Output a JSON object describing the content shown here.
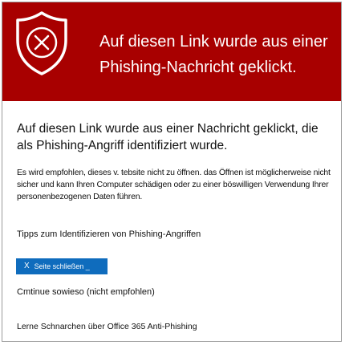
{
  "banner": {
    "title": "Auf diesen Link wurde aus einer Phishing-Nachricht geklickt.",
    "icon": "shield-x-icon",
    "color": "#a80000"
  },
  "body": {
    "headline": "Auf diesen Link wurde aus einer Nachricht geklickt, die als Phishing-Angriff identifiziert wurde.",
    "description": "Es wird empfohlen, dieses v. tebsite nicht zu öffnen. das Öffnen ist möglicherweise nicht sicher und kann Ihren Computer schädigen oder zu einer böswilligen Verwendung Ihrer personenbezogenen Daten führen.",
    "tips_link": "Tipps zum Identifizieren von Phishing-Angriffen",
    "close_button": {
      "icon": "close-icon",
      "x_glyph": "X",
      "label": "Seite schließen _",
      "color": "#0f6cbd"
    },
    "continue_link": "Cmtinue sowieso (nicht empfohlen)",
    "learn_link": "Lerne Schnarchen über Office 365 Anti-Phishing"
  }
}
